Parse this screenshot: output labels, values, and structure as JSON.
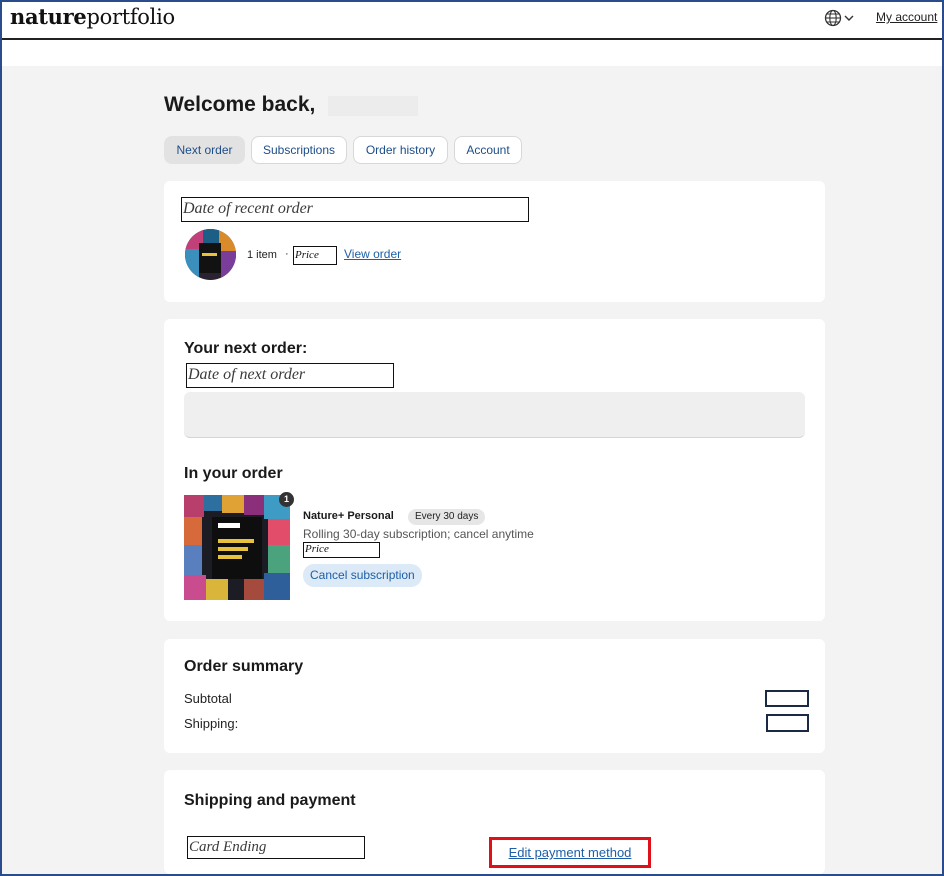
{
  "header": {
    "logo_bold": "nature",
    "logo_rest": "portfolio",
    "my_account": "My account"
  },
  "page": {
    "welcome": "Welcome back,"
  },
  "tabs": [
    {
      "label": "Next order",
      "active": true
    },
    {
      "label": "Subscriptions",
      "active": false
    },
    {
      "label": "Order history",
      "active": false
    },
    {
      "label": "Account",
      "active": false
    }
  ],
  "recent_order": {
    "date_placeholder": "Date of recent order",
    "item_count": "1 item",
    "separator": "·",
    "price_placeholder": "Price",
    "view_order": "View order"
  },
  "next_order": {
    "title": "Your next order:",
    "date_placeholder": "Date of next order",
    "in_your_order": "In your order",
    "product_name": "Nature+ Personal",
    "frequency": "Every 30 days",
    "description": "Rolling 30-day subscription; cancel anytime",
    "price_placeholder": "Price",
    "cancel_label": "Cancel subscription",
    "item_badge": "1"
  },
  "summary": {
    "title": "Order summary",
    "subtotal_label": "Subtotal",
    "shipping_label": "Shipping:"
  },
  "shipping_payment": {
    "title": "Shipping and payment",
    "card_placeholder": "Card Ending",
    "edit_payment": "Edit payment method"
  },
  "colors": {
    "link": "#1d5fa8",
    "highlight": "#e0101a",
    "background": "#f3f3f3"
  }
}
